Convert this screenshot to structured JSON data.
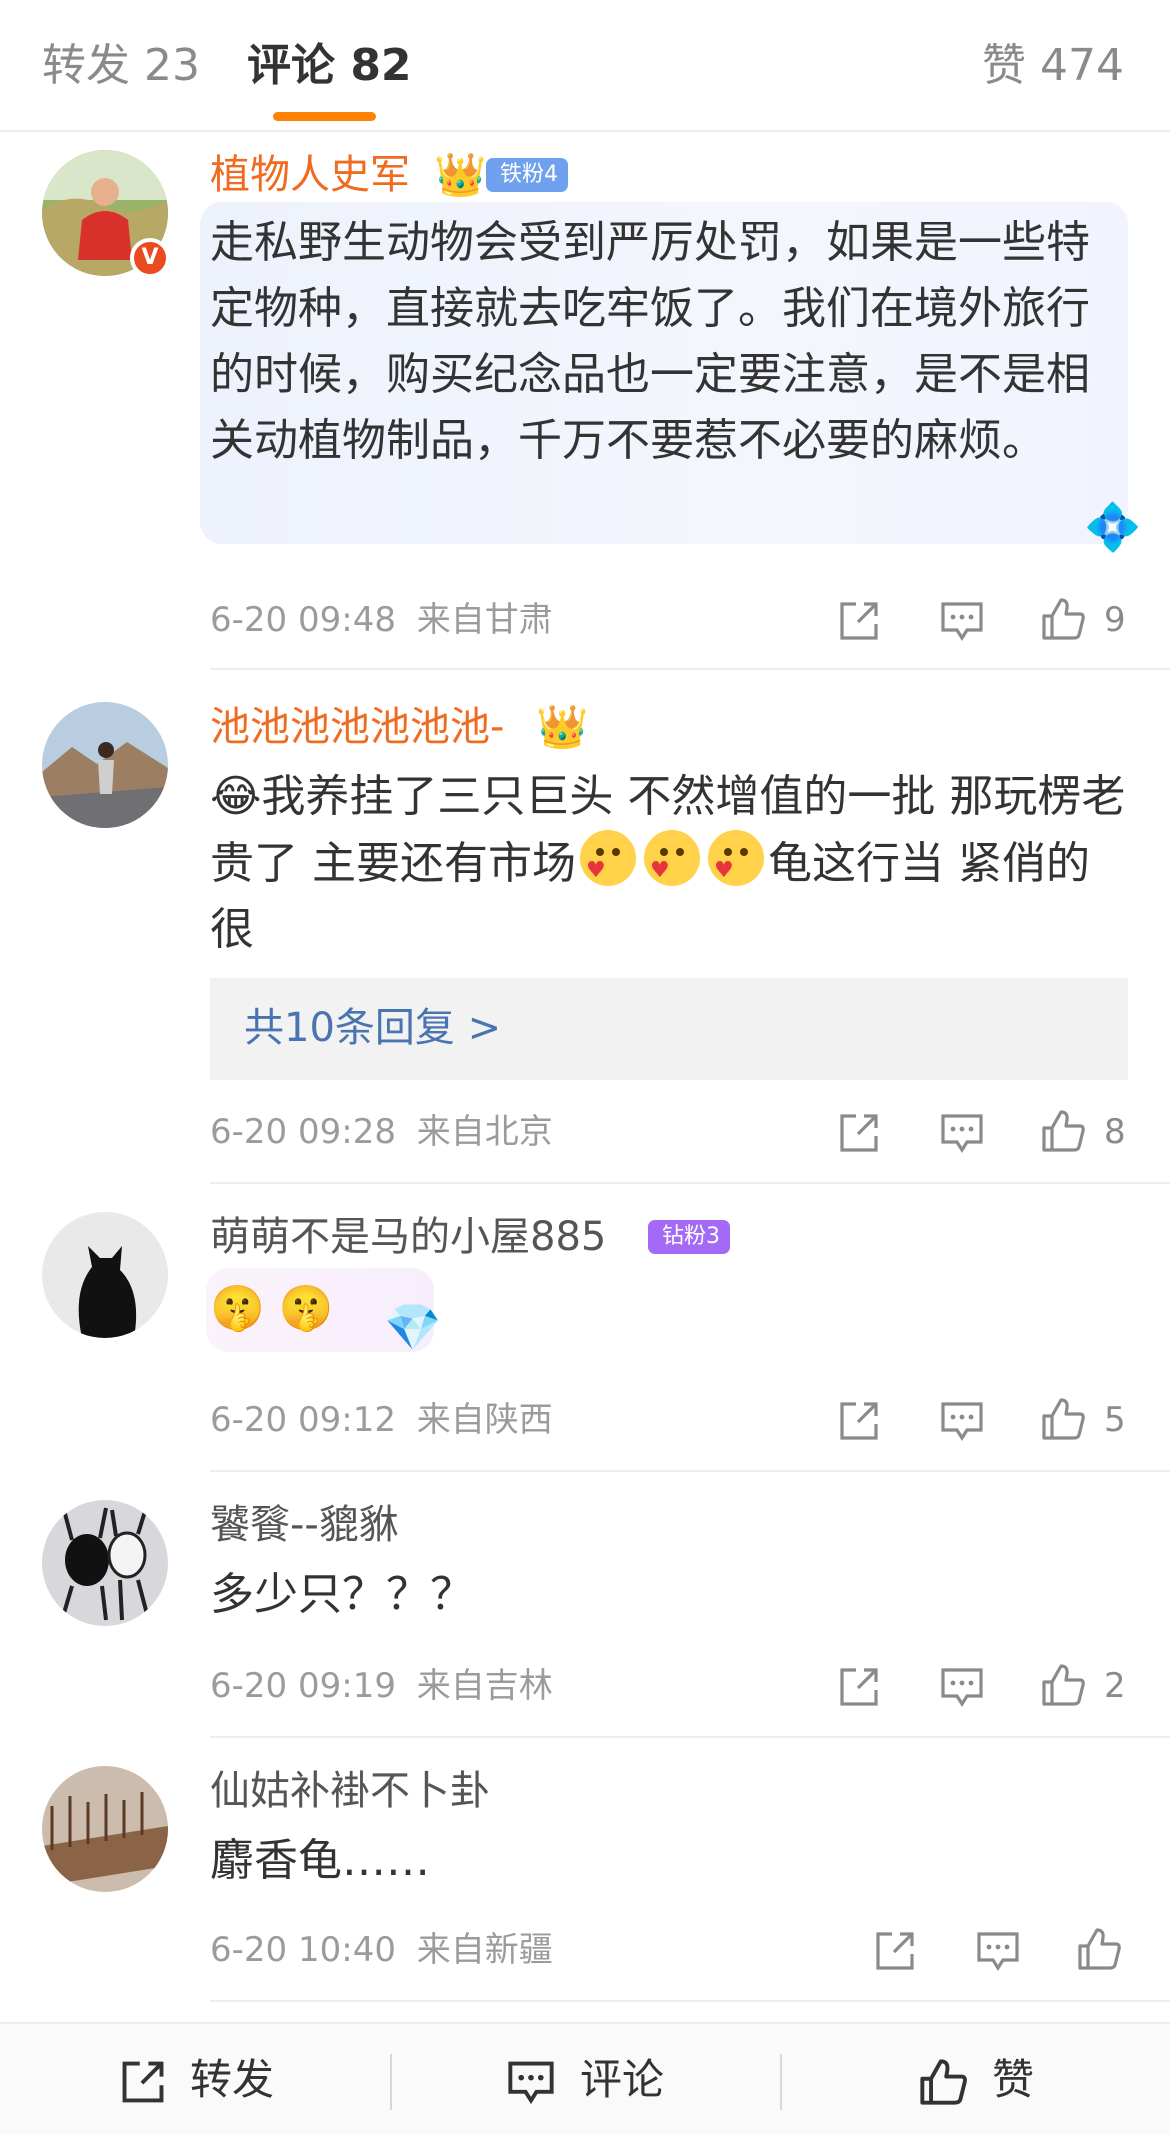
{
  "tabs": {
    "repost": "转发 23",
    "comments": "评论 82",
    "likes": "赞 474",
    "active_color": "#ff8200"
  },
  "comments": [
    {
      "name": "植物人史军",
      "badge": "铁粉4",
      "verified": "V",
      "text": "走私野生动物会受到严厉处罚，如果是一些特定物种，直接就去吃牢饭了。我们在境外旅行的时候，购买纪念品也一定要注意，是不是相关动植物制品，千万不要惹不必要的麻烦。",
      "time": "6-20 09:48",
      "location": "来自甘肃",
      "likes": "9"
    },
    {
      "name": "池池池池池池池-",
      "text_parts": [
        "我养挂了三只巨头 不然增值的一批 那玩楞老贵了 主要还有市场",
        "龟这行当 紧俏的很"
      ],
      "replies": "共10条回复 >",
      "time": "6-20 09:28",
      "location": "来自北京",
      "likes": "8"
    },
    {
      "name": "萌萌不是马的小屋885",
      "badge": "钻粉3",
      "time": "6-20 09:12",
      "location": "来自陕西",
      "likes": "5"
    },
    {
      "name": "饕餮--貔貅",
      "text": "多少只？？？",
      "time": "6-20 09:19",
      "location": "来自吉林",
      "likes": "2"
    },
    {
      "name": "仙姑补褂不卜卦",
      "text": "麝香龟……",
      "time": "6-20 10:40",
      "location": "来自新疆"
    }
  ],
  "bottom_bar": {
    "repost": "转发",
    "comment": "评论",
    "like": "赞"
  }
}
